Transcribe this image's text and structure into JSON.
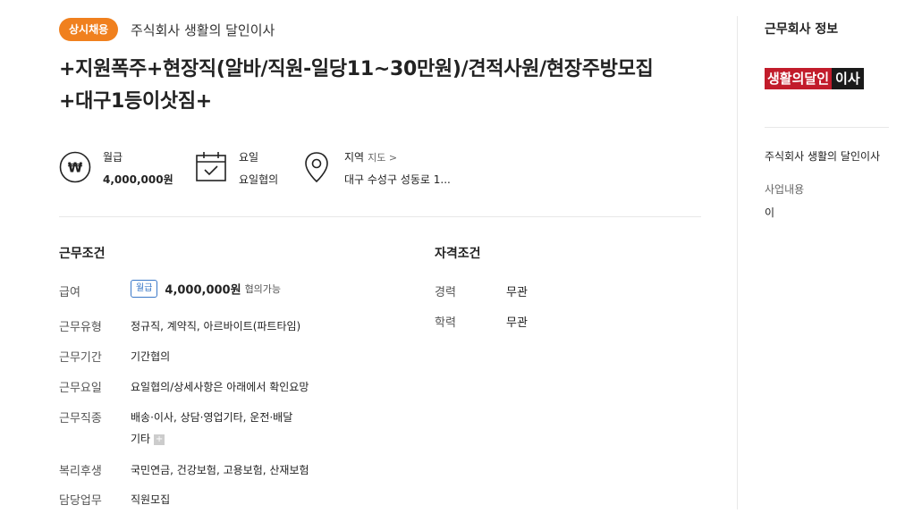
{
  "header": {
    "badge": "상시채용",
    "company": "주식회사 생활의 달인이사",
    "title_line1": "+지원폭주+현장직(알바/직원-일당11~30만원)/견적사원/현장주방모집",
    "title_line2": "+대구1등이삿짐+"
  },
  "summary": {
    "salary_label": "월급",
    "salary_value": "4,000,000원",
    "salary_icon": "won-icon",
    "day_label": "요일",
    "day_value": "요일협의",
    "day_icon": "calendar-check-icon",
    "region_label": "지역",
    "region_map_link": "지도 >",
    "region_value": "대구 수성구 성동로 1...",
    "region_icon": "location-pin-icon"
  },
  "conditions": {
    "title": "근무조건",
    "rows": [
      {
        "label": "급여",
        "tag": "월급",
        "amount": "4,000,000원",
        "note": "협의가능"
      },
      {
        "label": "근무유형",
        "value": "정규직, 계약직, 아르바이트(파트타임)"
      },
      {
        "label": "근무기간",
        "value": "기간협의"
      },
      {
        "label": "근무요일",
        "value": "요일협의/상세사항은 아래에서 확인요망"
      },
      {
        "label": "근무직종",
        "value": "배송·이사, 상담·영업기타, 운전·배달",
        "value2": "기타"
      },
      {
        "label": "복리후생",
        "value": "국민연금, 건강보험, 고용보험, 산재보험"
      },
      {
        "label": "담당업무",
        "value": "직원모집"
      }
    ]
  },
  "qualifications": {
    "title": "자격조건",
    "rows": [
      {
        "label": "경력",
        "value": "무관"
      },
      {
        "label": "학력",
        "value": "무관"
      }
    ]
  },
  "sidebar": {
    "title": "근무회사 정보",
    "logo_red": "생활의달인",
    "logo_dark": "이사",
    "company": "주식회사 생활의 달인이사",
    "business_label": "사업내용",
    "business_value": "이"
  },
  "colors": {
    "badge": "#f0801e",
    "pay_tag": "#3a78c8",
    "logo_red": "#c21c2b"
  }
}
